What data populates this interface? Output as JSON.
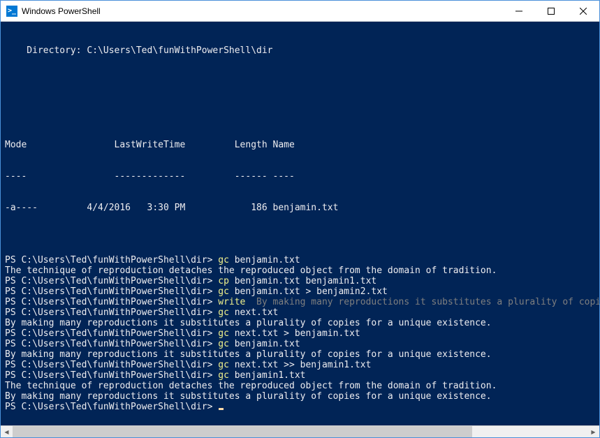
{
  "window": {
    "title": "Windows PowerShell",
    "icon_glyph": ">_"
  },
  "terminal": {
    "directory_header": "    Directory: C:\\Users\\Ted\\funWithPowerShell\\dir",
    "blank": "",
    "table_header": "Mode                LastWriteTime         Length Name",
    "table_divider": "----                -------------         ------ ----",
    "table_row": "-a----         4/4/2016   3:30 PM            186 benjamin.txt",
    "prompt": "PS C:\\Users\\Ted\\funWithPowerShell\\dir> ",
    "lines": [
      {
        "type": "blank"
      },
      {
        "type": "blank"
      },
      {
        "type": "cmd",
        "cmd": "gc",
        "args": " benjamin.txt"
      },
      {
        "type": "out",
        "text": "The technique of reproduction detaches the reproduced object from the domain of tradition."
      },
      {
        "type": "cmd",
        "cmd": "cp",
        "args": " benjamin.txt benjamin1.txt"
      },
      {
        "type": "cmd",
        "cmd": "gc",
        "args": " benjamin.txt > benjamin2.txt"
      },
      {
        "type": "cmd",
        "cmd": "write",
        "args": "",
        "trail_gray": "  By making many reproductions it substitutes a plurality of copies for a un"
      },
      {
        "type": "cmd",
        "cmd": "gc",
        "args": " next.txt"
      },
      {
        "type": "out",
        "text": "By making many reproductions it substitutes a plurality of copies for a unique existence."
      },
      {
        "type": "cmd",
        "cmd": "gc",
        "args": " next.txt > benjamin.txt"
      },
      {
        "type": "cmd",
        "cmd": "gc",
        "args": " benjamin.txt"
      },
      {
        "type": "out",
        "text": "By making many reproductions it substitutes a plurality of copies for a unique existence."
      },
      {
        "type": "cmd",
        "cmd": "gc",
        "args": " next.txt >> benjamin1.txt"
      },
      {
        "type": "cmd",
        "cmd": "gc",
        "args": " benjamin1.txt"
      },
      {
        "type": "out",
        "text": "The technique of reproduction detaches the reproduced object from the domain of tradition."
      },
      {
        "type": "out",
        "text": "By making many reproductions it substitutes a plurality of copies for a unique existence."
      },
      {
        "type": "cursor"
      }
    ]
  },
  "scrollbar": {
    "left_arrow": "◀",
    "right_arrow": "▶"
  }
}
